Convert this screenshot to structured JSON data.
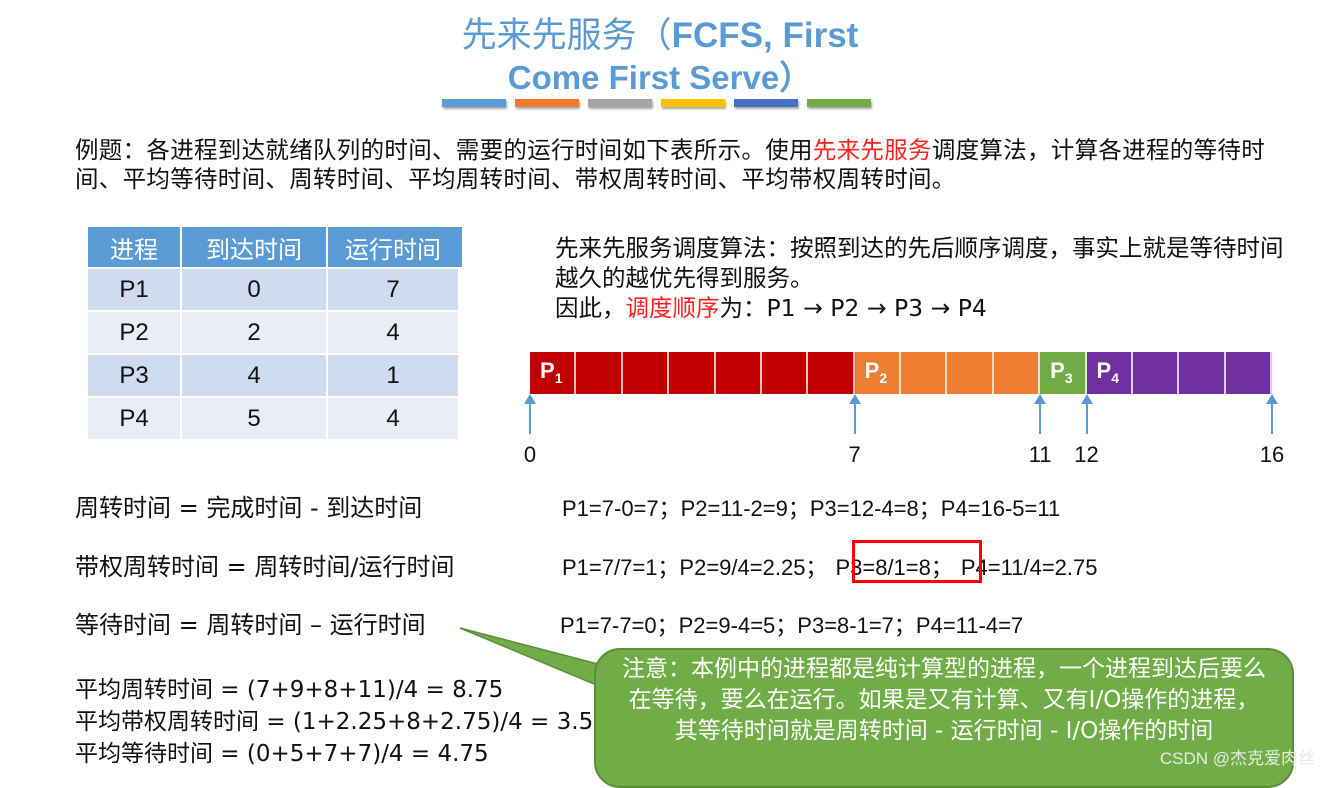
{
  "title": {
    "line1_cn": "先来先服务（",
    "line1_en": "FCFS, First",
    "line2": "Come First Serve）",
    "deco_colors": [
      "#5b9bd5",
      "#ed7d31",
      "#a5a5a5",
      "#ffc000",
      "#4472c4",
      "#70ad47"
    ]
  },
  "intro": {
    "part1": "例题：各进程到达就绪队列的时间、需要的运行时间如下表所示。使用",
    "highlight": "先来先服务",
    "part2": "调度算法，计算各进程的等待时间、平均等待时间、周转时间、平均周转时间、带权周转时间、平均带权周转时间。"
  },
  "table": {
    "headers": [
      "进程",
      "到达时间",
      "运行时间"
    ],
    "rows": [
      [
        "P1",
        "0",
        "7"
      ],
      [
        "P2",
        "2",
        "4"
      ],
      [
        "P3",
        "4",
        "1"
      ],
      [
        "P4",
        "5",
        "4"
      ]
    ]
  },
  "explain": {
    "line1": "先来先服务调度算法：按照到达的先后顺序调度，事实上就是等待时间越久的越优先得到服务。",
    "line2_prefix": "因此，",
    "line2_highlight": "调度顺序",
    "line2_suffix": "为：P1 → P2 → P3 → P4"
  },
  "gantt": {
    "total": 16,
    "segments": [
      {
        "name": "P",
        "sub": "1",
        "start": 0,
        "end": 7,
        "color": "#c00000"
      },
      {
        "name": "P",
        "sub": "2",
        "start": 7,
        "end": 11,
        "color": "#ed7d31"
      },
      {
        "name": "P",
        "sub": "3",
        "start": 11,
        "end": 12,
        "color": "#70ad47"
      },
      {
        "name": "P",
        "sub": "4",
        "start": 12,
        "end": 16,
        "color": "#7030a0"
      }
    ],
    "ticks": [
      "0",
      "7",
      "11",
      "12",
      "16"
    ],
    "tick_values": [
      0,
      7,
      11,
      12,
      16
    ]
  },
  "formulas": {
    "turnaround": "周转时间 = 完成时间 - 到达时间",
    "weighted": "带权周转时间 = 周转时间/运行时间",
    "waiting": "等待时间 = 周转时间 – 运行时间"
  },
  "calcs": {
    "turnaround": "P1=7-0=7；P2=11-2=9；P3=12-4=8；P4=16-5=11",
    "weighted_a": "P1=7/7=1；P2=9/4=2.25；",
    "weighted_hl": "P3=8/1=8；",
    "weighted_b": "P4=11/4=2.75",
    "waiting": "P1=7-7=0；P2=9-4=5；P3=8-1=7；P4=11-4=7"
  },
  "averages": {
    "turnaround": "平均周转时间 = (7+9+8+11)/4 = 8.75",
    "weighted": "平均带权周转时间 = (1+2.25+8+2.75)/4 = 3.5",
    "waiting": "平均等待时间 = (0+5+7+7)/4 = 4.75"
  },
  "callout": {
    "text": "注意：本例中的进程都是纯计算型的进程，一个进程到达后要么在等待，要么在运行。如果是又有计算、又有I/O操作的进程，其等待时间就是周转时间 - 运行时间 - I/O操作的时间"
  },
  "watermark": "CSDN @杰克爱肉丝"
}
